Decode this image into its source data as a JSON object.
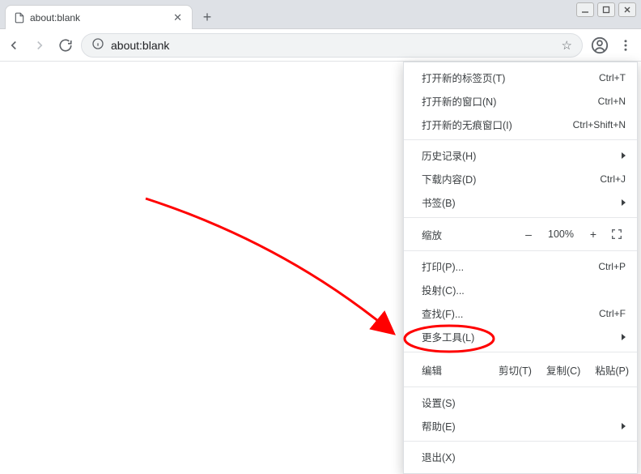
{
  "tab": {
    "title": "about:blank"
  },
  "address": {
    "url": "about:blank"
  },
  "menu": {
    "new_tab": "打开新的标签页(T)",
    "new_tab_sc": "Ctrl+T",
    "new_window": "打开新的窗口(N)",
    "new_window_sc": "Ctrl+N",
    "incognito": "打开新的无痕窗口(I)",
    "incognito_sc": "Ctrl+Shift+N",
    "history": "历史记录(H)",
    "downloads": "下载内容(D)",
    "downloads_sc": "Ctrl+J",
    "bookmarks": "书签(B)",
    "zoom_label": "缩放",
    "zoom_minus": "–",
    "zoom_pct": "100%",
    "zoom_plus": "+",
    "print": "打印(P)...",
    "print_sc": "Ctrl+P",
    "cast": "投射(C)...",
    "find": "查找(F)...",
    "find_sc": "Ctrl+F",
    "more_tools": "更多工具(L)",
    "edit_label": "编辑",
    "cut": "剪切(T)",
    "copy": "复制(C)",
    "paste": "粘贴(P)",
    "settings": "设置(S)",
    "help": "帮助(E)",
    "exit": "退出(X)"
  }
}
